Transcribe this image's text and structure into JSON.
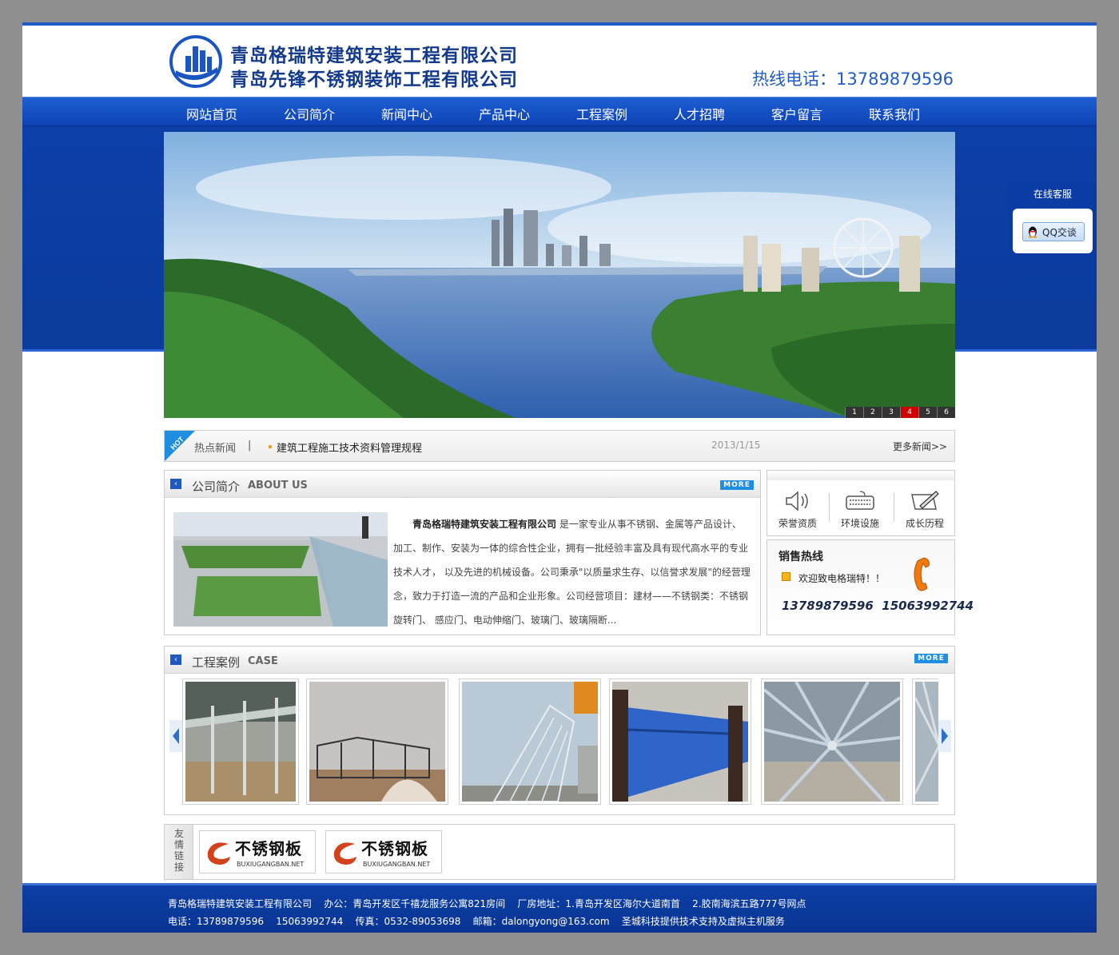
{
  "header": {
    "company_name_1": "青岛格瑞特建筑安装工程有限公司",
    "company_name_2": "青岛先锋不锈钢装饰工程有限公司",
    "hotline_label": "热线电话：",
    "hotline_number": "13789879596"
  },
  "nav": {
    "items": [
      "网站首页",
      "公司简介",
      "新闻中心",
      "产品中心",
      "工程案例",
      "人才招聘",
      "客户留言",
      "联系我们"
    ]
  },
  "banner": {
    "dots": [
      "1",
      "2",
      "3",
      "4",
      "5",
      "6"
    ],
    "active_dot": "4"
  },
  "chat": {
    "title": "在线客服",
    "qq_label": "QQ交谈"
  },
  "news": {
    "badge": "HOT",
    "label": "热点新闻",
    "separator": "|",
    "headline": "建筑工程施工技术资料管理规程",
    "date": "2013/1/15",
    "more": "更多新闻>>"
  },
  "about": {
    "title_cn": "公司简介",
    "title_en": "ABOUT US",
    "more": "MORE",
    "company_bold": "青岛格瑞特建筑安装工程有限公司",
    "text": "是一家专业从事不锈钢、金属等产品设计、加工、制作、安装为一体的综合性企业，拥有一批经验丰富及具有现代高水平的专业技术人才， 以及先进的机械设备。公司秉承\"以质量求生存、以信誉求发展\"的经营理念，致力于打造一流的产品和企业形象。公司经营项目：建材——不锈钢类：不锈钢旋转门、 感应门、电动伸缩门、玻璃门、玻璃隔断..."
  },
  "side": {
    "cells": [
      "荣誉资质",
      "环境设施",
      "成长历程"
    ],
    "sales_title": "销售热线",
    "welcome": "欢迎致电格瑞特！！",
    "phones": "13789879596  15063992744"
  },
  "cases": {
    "title_cn": "工程案例",
    "title_en": "CASE",
    "more": "MORE"
  },
  "links": {
    "label": "友情链接",
    "items": [
      {
        "name": "不锈钢板",
        "domain": "BUXIUGANGBAN.NET"
      },
      {
        "name": "不锈钢板",
        "domain": "BUXIUGANGBAN.NET"
      }
    ]
  },
  "footer": {
    "line1": "青岛格瑞特建筑安装工程有限公司    办公：青岛开发区千禧龙服务公寓821房间    厂房地址：1.青岛开发区海尔大道南首    2.胶南海滨五路777号网点",
    "line2": "电话：13789879596    15063992744    传真：0532-89053698    邮箱：dalongyong@163.com    圣城科技提供技术支持及虚拟主机服务"
  },
  "colors": {
    "brand_blue": "#0c3fa8",
    "nav_blue": "#1e5fd4",
    "active_red": "#d10000"
  }
}
